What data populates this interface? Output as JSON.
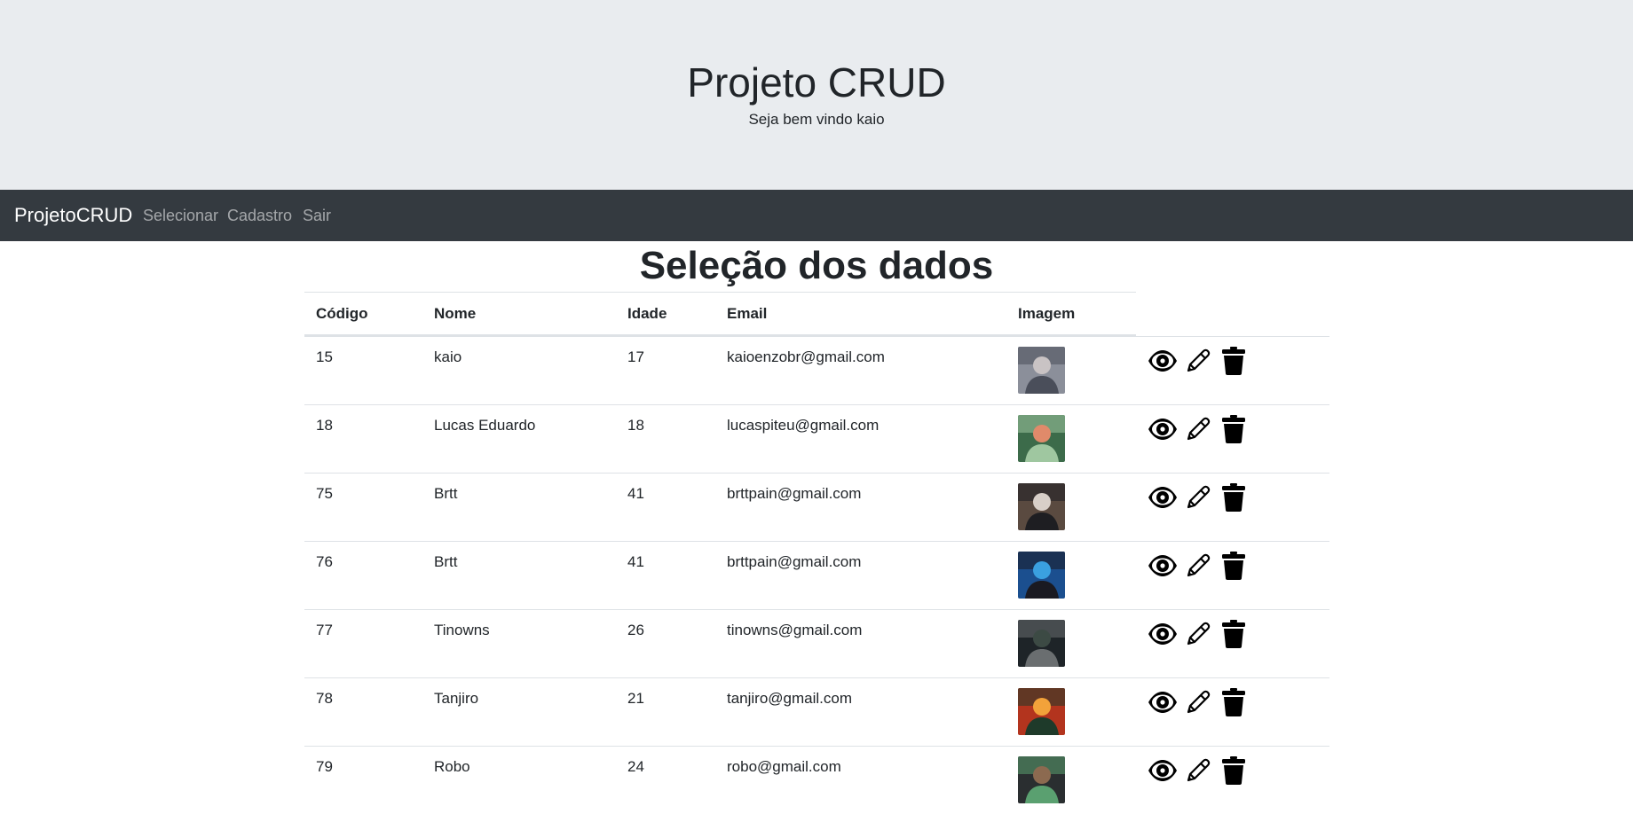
{
  "header": {
    "title": "Projeto CRUD",
    "subtitle": "Seja bem vindo kaio"
  },
  "navbar": {
    "brand": "ProjetoCRUD",
    "links": [
      "Selecionar",
      "Cadastro",
      "Sair"
    ]
  },
  "main": {
    "title": "Seleção dos dados",
    "table": {
      "columns": [
        "Código",
        "Nome",
        "Idade",
        "Email",
        "Imagem"
      ],
      "rows": [
        {
          "codigo": "15",
          "nome": "kaio",
          "idade": "17",
          "email": "kaioenzobr@gmail.com"
        },
        {
          "codigo": "18",
          "nome": "Lucas Eduardo",
          "idade": "18",
          "email": "lucaspiteu@gmail.com"
        },
        {
          "codigo": "75",
          "nome": "Brtt",
          "idade": "41",
          "email": "brttpain@gmail.com"
        },
        {
          "codigo": "76",
          "nome": "Brtt",
          "idade": "41",
          "email": "brttpain@gmail.com"
        },
        {
          "codigo": "77",
          "nome": "Tinowns",
          "idade": "26",
          "email": "tinowns@gmail.com"
        },
        {
          "codigo": "78",
          "nome": "Tanjiro",
          "idade": "21",
          "email": "tanjiro@gmail.com"
        },
        {
          "codigo": "79",
          "nome": "Robo",
          "idade": "24",
          "email": "robo@gmail.com"
        }
      ]
    },
    "row_actions": [
      "eye-icon",
      "pencil-icon",
      "trash-icon"
    ]
  },
  "colors": {
    "jumbotron_bg": "#e9ecef",
    "navbar_bg": "#343a40",
    "text": "#212529",
    "border": "#dee2e6"
  }
}
